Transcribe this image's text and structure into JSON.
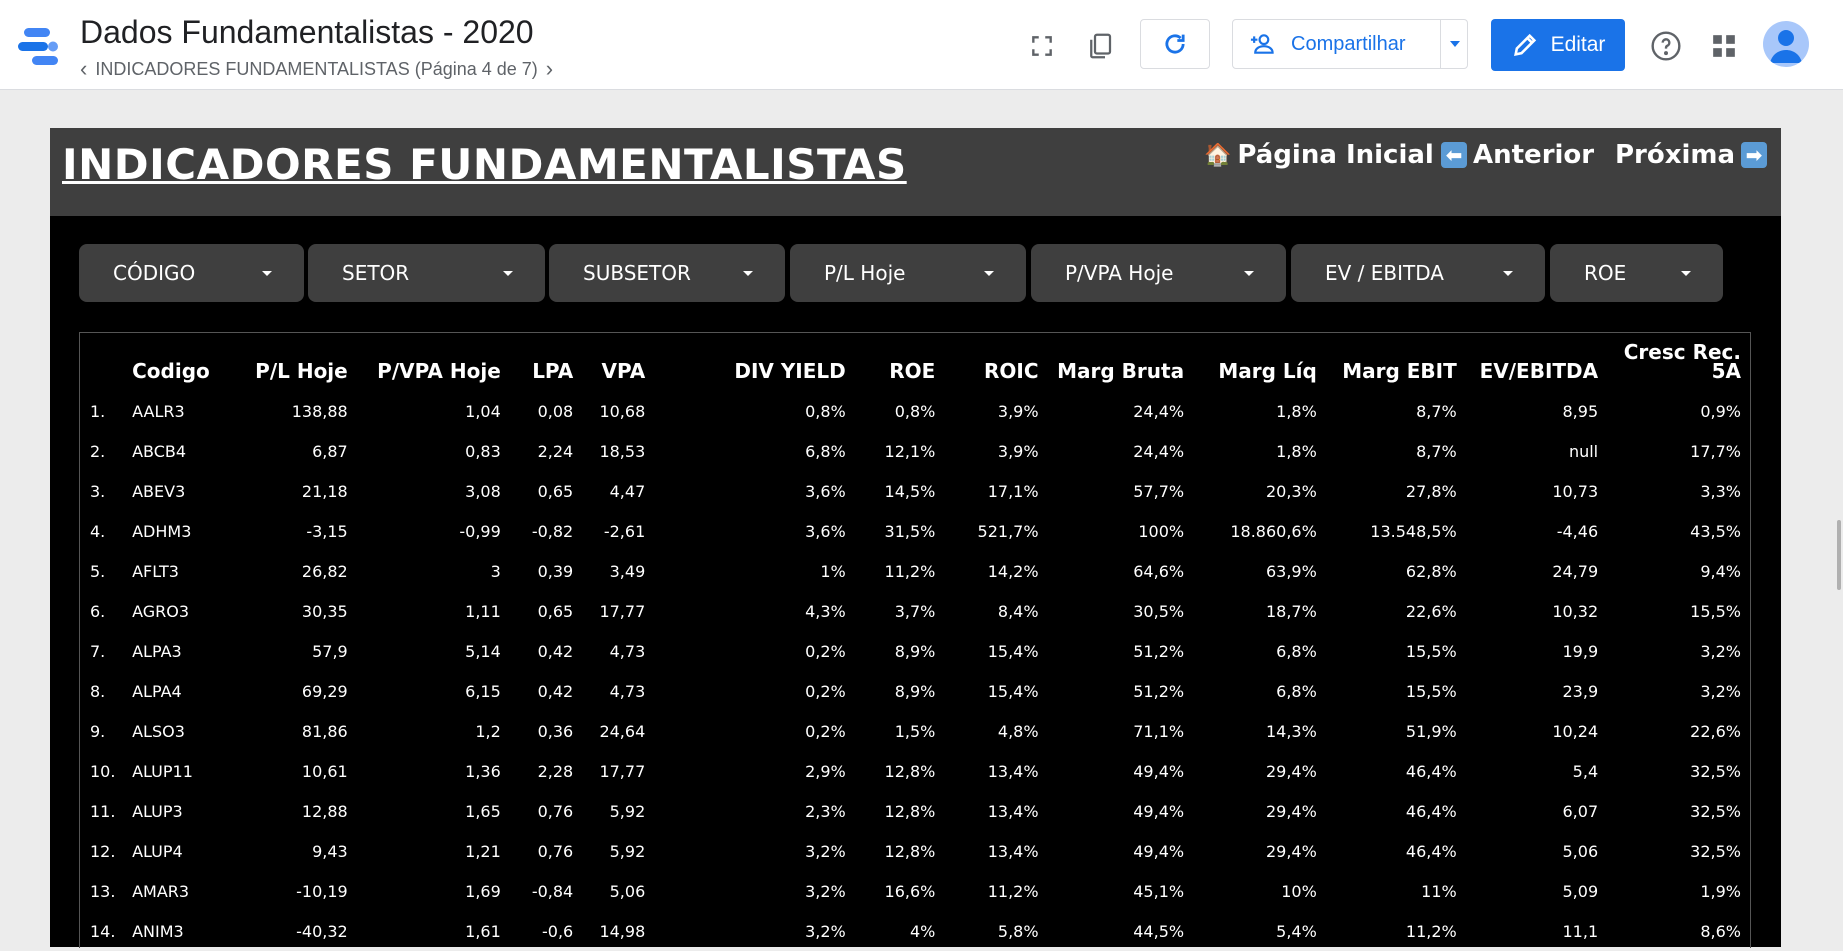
{
  "app": {
    "title": "Dados Fundamentalistas - 2020",
    "breadcrumb": "INDICADORES FUNDAMENTALISTAS (Página 4 de 7)",
    "share_label": "Compartilhar",
    "edit_label": "Editar",
    "icons": [
      "fullscreen-icon",
      "copy-icon",
      "refresh-icon",
      "add-person-icon",
      "chevron-down-icon",
      "pencil-icon",
      "help-icon",
      "apps-grid-icon"
    ],
    "colors": {
      "accent": "#1a73e8",
      "report_bg": "#000000",
      "header_bg": "#3f3f3f"
    }
  },
  "report": {
    "title": "INDICADORES FUNDAMENTALISTAS",
    "nav": {
      "home_icon": "🏠",
      "home": "Página Inicial",
      "prev_icon": "⬅",
      "prev": "Anterior",
      "next": "Próxima",
      "next_icon": "➡"
    },
    "filters": [
      "CÓDIGO",
      "SETOR",
      "SUBSETOR",
      "P/L Hoje",
      "P/VPA Hoje",
      "EV / EBITDA",
      "ROE"
    ],
    "columns": [
      "",
      "Codigo",
      "P/L Hoje",
      "P/VPA Hoje",
      "LPA",
      "VPA",
      "DIV YIELD",
      "ROE",
      "ROIC",
      "Marg Bruta",
      "Marg Líq",
      "Marg EBIT",
      "EV/EBITDA",
      "Cresc Rec. 5A"
    ],
    "rows": [
      [
        "1.",
        "AALR3",
        "138,88",
        "1,04",
        "0,08",
        "10,68",
        "0,8%",
        "0,8%",
        "3,9%",
        "24,4%",
        "1,8%",
        "8,7%",
        "8,95",
        "0,9%"
      ],
      [
        "2.",
        "ABCB4",
        "6,87",
        "0,83",
        "2,24",
        "18,53",
        "6,8%",
        "12,1%",
        "3,9%",
        "24,4%",
        "1,8%",
        "8,7%",
        "null",
        "17,7%"
      ],
      [
        "3.",
        "ABEV3",
        "21,18",
        "3,08",
        "0,65",
        "4,47",
        "3,6%",
        "14,5%",
        "17,1%",
        "57,7%",
        "20,3%",
        "27,8%",
        "10,73",
        "3,3%"
      ],
      [
        "4.",
        "ADHM3",
        "-3,15",
        "-0,99",
        "-0,82",
        "-2,61",
        "3,6%",
        "31,5%",
        "521,7%",
        "100%",
        "18.860,6%",
        "13.548,5%",
        "-4,46",
        "43,5%"
      ],
      [
        "5.",
        "AFLT3",
        "26,82",
        "3",
        "0,39",
        "3,49",
        "1%",
        "11,2%",
        "14,2%",
        "64,6%",
        "63,9%",
        "62,8%",
        "24,79",
        "9,4%"
      ],
      [
        "6.",
        "AGRO3",
        "30,35",
        "1,11",
        "0,65",
        "17,77",
        "4,3%",
        "3,7%",
        "8,4%",
        "30,5%",
        "18,7%",
        "22,6%",
        "10,32",
        "15,5%"
      ],
      [
        "7.",
        "ALPA3",
        "57,9",
        "5,14",
        "0,42",
        "4,73",
        "0,2%",
        "8,9%",
        "15,4%",
        "51,2%",
        "6,8%",
        "15,5%",
        "19,9",
        "3,2%"
      ],
      [
        "8.",
        "ALPA4",
        "69,29",
        "6,15",
        "0,42",
        "4,73",
        "0,2%",
        "8,9%",
        "15,4%",
        "51,2%",
        "6,8%",
        "15,5%",
        "23,9",
        "3,2%"
      ],
      [
        "9.",
        "ALSO3",
        "81,86",
        "1,2",
        "0,36",
        "24,64",
        "0,2%",
        "1,5%",
        "4,8%",
        "71,1%",
        "14,3%",
        "51,9%",
        "10,24",
        "22,6%"
      ],
      [
        "10.",
        "ALUP11",
        "10,61",
        "1,36",
        "2,28",
        "17,77",
        "2,9%",
        "12,8%",
        "13,4%",
        "49,4%",
        "29,4%",
        "46,4%",
        "5,4",
        "32,5%"
      ],
      [
        "11.",
        "ALUP3",
        "12,88",
        "1,65",
        "0,76",
        "5,92",
        "2,3%",
        "12,8%",
        "13,4%",
        "49,4%",
        "29,4%",
        "46,4%",
        "6,07",
        "32,5%"
      ],
      [
        "12.",
        "ALUP4",
        "9,43",
        "1,21",
        "0,76",
        "5,92",
        "3,2%",
        "12,8%",
        "13,4%",
        "49,4%",
        "29,4%",
        "46,4%",
        "5,06",
        "32,5%"
      ],
      [
        "13.",
        "AMAR3",
        "-10,19",
        "1,69",
        "-0,84",
        "5,06",
        "3,2%",
        "16,6%",
        "11,2%",
        "45,1%",
        "10%",
        "11%",
        "5,09",
        "1,9%"
      ],
      [
        "14.",
        "ANIM3",
        "-40,32",
        "1,61",
        "-0,6",
        "14,98",
        "3,2%",
        "4%",
        "5,8%",
        "44,5%",
        "5,4%",
        "11,2%",
        "11,1",
        "8,6%"
      ]
    ]
  }
}
